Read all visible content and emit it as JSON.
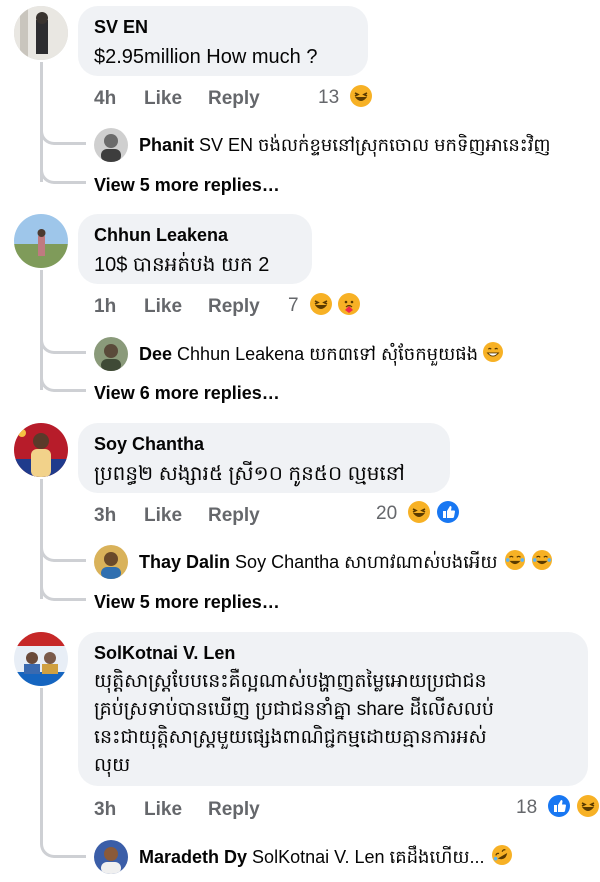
{
  "comments": [
    {
      "author": "SV EN",
      "text": "$2.95million How much ?",
      "time": "4h",
      "like": "Like",
      "reply": "Reply",
      "reactions": "13",
      "reply_preview": {
        "name": "Phanit",
        "text": "SV EN ចង់លក់ខ្ទមនៅស្រុកចោល មកទិញអានេះវិញ"
      },
      "more_replies": "View 5 more replies…"
    },
    {
      "author": "Chhun Leakena",
      "text": "10$ បានអត់បង យក 2",
      "time": "1h",
      "like": "Like",
      "reply": "Reply",
      "reactions": "7",
      "reply_preview": {
        "name": "Dee",
        "text": "Chhun Leakena យក៣ទៅ  សុំចែកមួយផង"
      },
      "more_replies": "View 6 more replies…"
    },
    {
      "author": "Soy Chantha",
      "text": "ប្រពន្ធ២ សង្សារ៥ ស្រី១០ កូន៥០ ល្មមនៅ",
      "time": "3h",
      "like": "Like",
      "reply": "Reply",
      "reactions": "20",
      "reply_preview": {
        "name": "Thay Dalin",
        "text": "Soy Chantha សាហាវណាស់បងអើយ"
      },
      "more_replies": "View 5 more replies…"
    },
    {
      "author": "SolKotnai V. Len",
      "text_lines": [
        "យុត្តិសាស្ត្របែបនេះគឺល្អណាស់បង្ហាញតម្លៃអោយប្រជាជន",
        "គ្រប់ស្រទាប់បានឃើញ ប្រជាជននាំគ្នា share ដីលើសលប់",
        "នេះជាយុត្តិសាស្ត្រមួយផ្សេងពាណិជ្ជកម្មដោយគ្មានការអស់",
        "លុយ"
      ],
      "time": "3h",
      "like": "Like",
      "reply": "Reply",
      "reactions": "18",
      "reply_preview": {
        "name": "Maradeth Dy",
        "text": "SolKotnai V. Len គេដឹងហើយ..."
      }
    }
  ],
  "colors": {
    "bubble": "#f0f2f5",
    "meta": "#65676b",
    "line": "#ced0d4",
    "like_blue": "#1877f2",
    "haha_yellow": "#f7b125"
  }
}
